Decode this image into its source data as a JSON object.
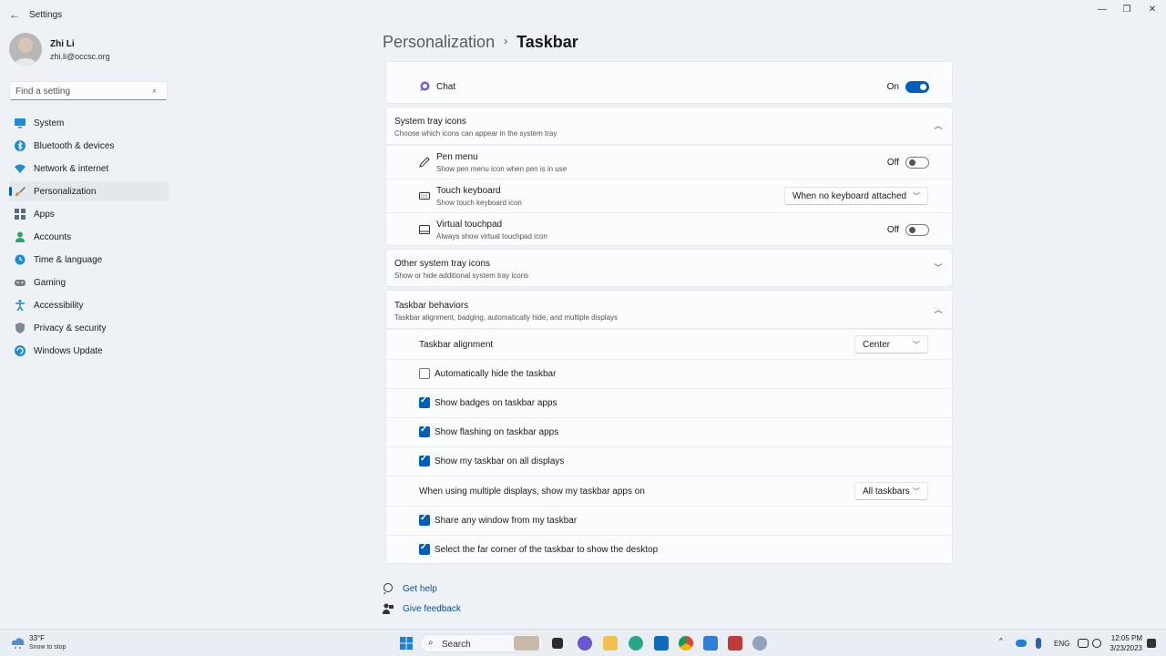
{
  "window": {
    "title": "Settings",
    "back_glyph": "←",
    "controls": {
      "minimize": "—",
      "maximize": "❐",
      "close": "✕"
    }
  },
  "profile": {
    "name": "Zhi Li",
    "email": "zhi.li@occsc.org"
  },
  "search": {
    "placeholder": "Find a setting",
    "icon": "search-icon"
  },
  "sidebar": {
    "items": [
      {
        "label": "System",
        "icon": "monitor-icon",
        "color": "#1f8ad6"
      },
      {
        "label": "Bluetooth & devices",
        "icon": "bluetooth-icon",
        "color": "#1f8ad6"
      },
      {
        "label": "Network & internet",
        "icon": "wifi-icon",
        "color": "#1f8ad6"
      },
      {
        "label": "Personalization",
        "icon": "brush-icon",
        "color": "#d98a2b",
        "active": true
      },
      {
        "label": "Apps",
        "icon": "apps-icon",
        "color": "#5b6b7a"
      },
      {
        "label": "Accounts",
        "icon": "person-icon",
        "color": "#2aa56b"
      },
      {
        "label": "Time & language",
        "icon": "globe-clock-icon",
        "color": "#1f8ad6"
      },
      {
        "label": "Gaming",
        "icon": "gamepad-icon",
        "color": "#7a7a7a"
      },
      {
        "label": "Accessibility",
        "icon": "accessibility-icon",
        "color": "#1f8ad6"
      },
      {
        "label": "Privacy & security",
        "icon": "shield-icon",
        "color": "#7a8a99"
      },
      {
        "label": "Windows Update",
        "icon": "update-icon",
        "color": "#1f8ad6"
      }
    ]
  },
  "breadcrumb": {
    "parent": "Personalization",
    "separator": "›",
    "current": "Taskbar"
  },
  "chat": {
    "label": "Chat",
    "state": "On",
    "on": true
  },
  "system_tray": {
    "title": "System tray icons",
    "subtitle": "Choose which icons can appear in the system tray",
    "items": {
      "pen": {
        "title": "Pen menu",
        "subtitle": "Show pen menu icon when pen is in use",
        "state": "Off"
      },
      "keyboard": {
        "title": "Touch keyboard",
        "subtitle": "Show touch keyboard icon",
        "value": "When no keyboard attached"
      },
      "touchpad": {
        "title": "Virtual touchpad",
        "subtitle": "Always show virtual touchpad icon",
        "state": "Off"
      }
    }
  },
  "other_tray": {
    "title": "Other system tray icons",
    "subtitle": "Show or hide additional system tray icons"
  },
  "behaviors": {
    "title": "Taskbar behaviors",
    "subtitle": "Taskbar alignment, badging, automatically hide, and multiple displays",
    "alignment": {
      "label": "Taskbar alignment",
      "value": "Center"
    },
    "auto_hide": {
      "label": "Automatically hide the taskbar",
      "checked": false
    },
    "badges": {
      "label": "Show badges on taskbar apps",
      "checked": true
    },
    "flashing": {
      "label": "Show flashing on taskbar apps",
      "checked": true
    },
    "all_displays": {
      "label": "Show my taskbar on all displays",
      "checked": true
    },
    "multi_display": {
      "label": "When using multiple displays, show my taskbar apps on",
      "value": "All taskbars"
    },
    "share_window": {
      "label": "Share any window from my taskbar",
      "checked": true
    },
    "far_corner": {
      "label": "Select the far corner of the taskbar to show the desktop",
      "checked": true
    }
  },
  "links": {
    "help": "Get help",
    "feedback": "Give feedback"
  },
  "taskbar": {
    "weather": {
      "temp": "33°F",
      "desc": "Snow to stop"
    },
    "search_label": "Search",
    "tray": {
      "language": "ENG",
      "chevron": "^"
    },
    "clock": {
      "time": "12:05 PM",
      "date": "3/23/2023"
    }
  },
  "colors": {
    "accent": "#005fb8",
    "link": "#004e9a"
  }
}
